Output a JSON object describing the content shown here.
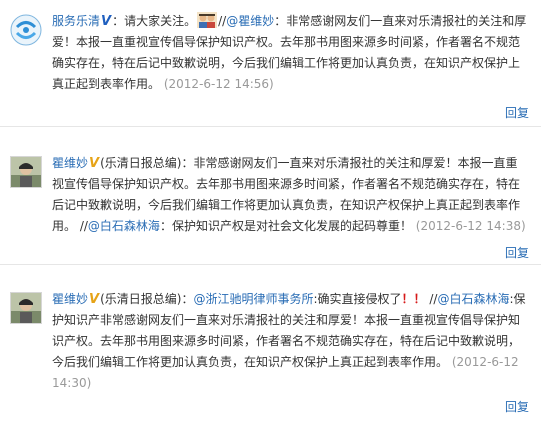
{
  "comments": [
    {
      "author": "服务乐清",
      "badge": "V",
      "text_a": "：请大家关注。",
      "text_b": "//",
      "mention": "@瞿维妙",
      "text_c": "：非常感谢网友们一直来对乐清报社的关注和厚爱！本报一直重视宣传倡导保护知识产权。去年那书用图来源多时间紧，作者署名不规范确实存在，特在后记中致歉说明，今后我们编辑工作将更加认真负责，在知识产权保护上真正起到表率作用。",
      "time": "(2012-6-12 14:56)",
      "reply": "回复"
    },
    {
      "author": "瞿维妙",
      "badge": "V",
      "text_a": "(乐清日报总编)：非常感谢网友们一直来对乐清报社的关注和厚爱！本报一直重视宣传倡导保护知识产权。去年那书用图来源多时间紧，作者署名不规范确实存在，特在后记中致歉说明，今后我们编辑工作将更加认真负责，在知识产权保护上真正起到表率作用。",
      "text_b": " //",
      "mention": "@白石森林海",
      "text_c": "：保护知识产权是对社会文化发展的起码尊重！",
      "time": "(2012-6-12 14:38)",
      "reply": "回复"
    },
    {
      "author": "瞿维妙",
      "badge": "V",
      "text_a": "(乐清日报总编)：",
      "mention_1": "@浙江驰明律师事务所",
      "text_b": ":确实直接侵权了",
      "marks": "！！",
      "text_c": " //",
      "mention_2": "@白石森林海",
      "text_d": ":保护知识产非常感谢网友们一直来对乐清报社的关注和厚爱！本报一直重视宣传倡导保护知识产权。去年那书用图来源多时间紧，作者署名不规范确实存在，特在后记中致歉说明，今后我们编辑工作将更加认真负责，在知识产权保护上真正起到表率作用。",
      "time": "(2012-6-12 14:30)",
      "reply": "回复"
    }
  ],
  "colors": {
    "link": "#2a6db5",
    "text": "#333333",
    "time": "#999999",
    "v_blue": "#1f5fbf",
    "v_gold": "#e6a317"
  },
  "icons": {
    "avatar_1": "org-logo-avatar",
    "avatar_2": "person-avatar",
    "emoji": "people-emoji-icon"
  }
}
